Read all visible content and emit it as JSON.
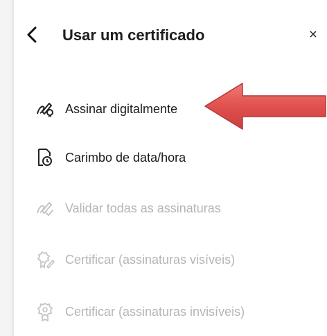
{
  "header": {
    "title": "Usar um certificado",
    "back_icon": "chevron-left-icon",
    "close_label": "×"
  },
  "menu": {
    "items": [
      {
        "label": "Assinar digitalmente",
        "icon": "sign-digitally-icon",
        "enabled": true
      },
      {
        "label": "Carimbo de data/hora",
        "icon": "timestamp-icon",
        "enabled": true
      },
      {
        "label": "Validar todas as assinaturas",
        "icon": "validate-signatures-icon",
        "enabled": false
      },
      {
        "label": "Certificar (assinaturas visíveis)",
        "icon": "certify-visible-icon",
        "enabled": false
      },
      {
        "label": "Certificar (assinaturas invisíveis)",
        "icon": "certify-invisible-icon",
        "enabled": false
      }
    ]
  },
  "annotation": {
    "arrow_color": "#e0504e",
    "points_to": "Assinar digitalmente"
  },
  "colors": {
    "text_enabled": "#1b1b1b",
    "text_disabled": "#b5b5b5"
  }
}
